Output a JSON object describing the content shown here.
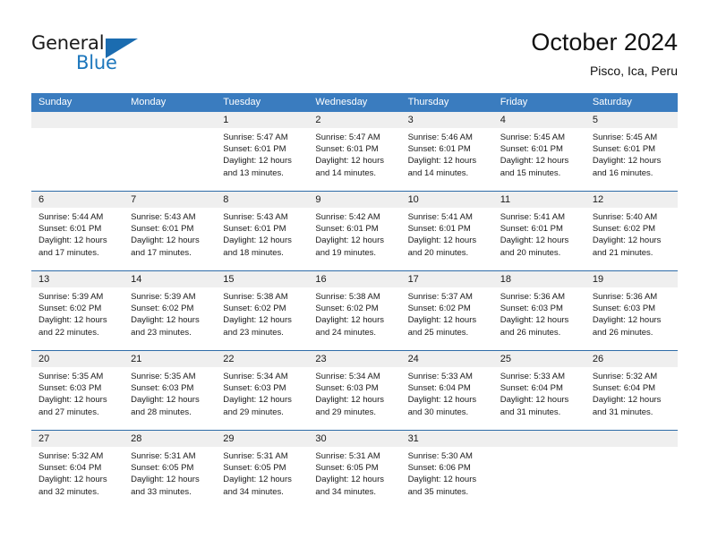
{
  "brand": {
    "name_part1": "General",
    "name_part2": "Blue",
    "logo_icon": "triangle-flag-icon"
  },
  "header": {
    "title": "October 2024",
    "subtitle": "Pisco, Ica, Peru"
  },
  "colors": {
    "header_blue": "#3a7cbf",
    "separator_blue": "#2f6ca8",
    "daynum_band": "#efefef",
    "brand_blue": "#1b76bc"
  },
  "weekdays": [
    "Sunday",
    "Monday",
    "Tuesday",
    "Wednesday",
    "Thursday",
    "Friday",
    "Saturday"
  ],
  "labels": {
    "sunrise_prefix": "Sunrise:",
    "sunset_prefix": "Sunset:",
    "daylight_prefix": "Daylight:"
  },
  "weeks": [
    {
      "days": [
        {
          "num": "",
          "empty": true
        },
        {
          "num": "",
          "empty": true
        },
        {
          "num": "1",
          "sunrise": "Sunrise: 5:47 AM",
          "sunset": "Sunset: 6:01 PM",
          "daylight1": "Daylight: 12 hours",
          "daylight2": "and 13 minutes."
        },
        {
          "num": "2",
          "sunrise": "Sunrise: 5:47 AM",
          "sunset": "Sunset: 6:01 PM",
          "daylight1": "Daylight: 12 hours",
          "daylight2": "and 14 minutes."
        },
        {
          "num": "3",
          "sunrise": "Sunrise: 5:46 AM",
          "sunset": "Sunset: 6:01 PM",
          "daylight1": "Daylight: 12 hours",
          "daylight2": "and 14 minutes."
        },
        {
          "num": "4",
          "sunrise": "Sunrise: 5:45 AM",
          "sunset": "Sunset: 6:01 PM",
          "daylight1": "Daylight: 12 hours",
          "daylight2": "and 15 minutes."
        },
        {
          "num": "5",
          "sunrise": "Sunrise: 5:45 AM",
          "sunset": "Sunset: 6:01 PM",
          "daylight1": "Daylight: 12 hours",
          "daylight2": "and 16 minutes."
        }
      ]
    },
    {
      "days": [
        {
          "num": "6",
          "sunrise": "Sunrise: 5:44 AM",
          "sunset": "Sunset: 6:01 PM",
          "daylight1": "Daylight: 12 hours",
          "daylight2": "and 17 minutes."
        },
        {
          "num": "7",
          "sunrise": "Sunrise: 5:43 AM",
          "sunset": "Sunset: 6:01 PM",
          "daylight1": "Daylight: 12 hours",
          "daylight2": "and 17 minutes."
        },
        {
          "num": "8",
          "sunrise": "Sunrise: 5:43 AM",
          "sunset": "Sunset: 6:01 PM",
          "daylight1": "Daylight: 12 hours",
          "daylight2": "and 18 minutes."
        },
        {
          "num": "9",
          "sunrise": "Sunrise: 5:42 AM",
          "sunset": "Sunset: 6:01 PM",
          "daylight1": "Daylight: 12 hours",
          "daylight2": "and 19 minutes."
        },
        {
          "num": "10",
          "sunrise": "Sunrise: 5:41 AM",
          "sunset": "Sunset: 6:01 PM",
          "daylight1": "Daylight: 12 hours",
          "daylight2": "and 20 minutes."
        },
        {
          "num": "11",
          "sunrise": "Sunrise: 5:41 AM",
          "sunset": "Sunset: 6:01 PM",
          "daylight1": "Daylight: 12 hours",
          "daylight2": "and 20 minutes."
        },
        {
          "num": "12",
          "sunrise": "Sunrise: 5:40 AM",
          "sunset": "Sunset: 6:02 PM",
          "daylight1": "Daylight: 12 hours",
          "daylight2": "and 21 minutes."
        }
      ]
    },
    {
      "days": [
        {
          "num": "13",
          "sunrise": "Sunrise: 5:39 AM",
          "sunset": "Sunset: 6:02 PM",
          "daylight1": "Daylight: 12 hours",
          "daylight2": "and 22 minutes."
        },
        {
          "num": "14",
          "sunrise": "Sunrise: 5:39 AM",
          "sunset": "Sunset: 6:02 PM",
          "daylight1": "Daylight: 12 hours",
          "daylight2": "and 23 minutes."
        },
        {
          "num": "15",
          "sunrise": "Sunrise: 5:38 AM",
          "sunset": "Sunset: 6:02 PM",
          "daylight1": "Daylight: 12 hours",
          "daylight2": "and 23 minutes."
        },
        {
          "num": "16",
          "sunrise": "Sunrise: 5:38 AM",
          "sunset": "Sunset: 6:02 PM",
          "daylight1": "Daylight: 12 hours",
          "daylight2": "and 24 minutes."
        },
        {
          "num": "17",
          "sunrise": "Sunrise: 5:37 AM",
          "sunset": "Sunset: 6:02 PM",
          "daylight1": "Daylight: 12 hours",
          "daylight2": "and 25 minutes."
        },
        {
          "num": "18",
          "sunrise": "Sunrise: 5:36 AM",
          "sunset": "Sunset: 6:03 PM",
          "daylight1": "Daylight: 12 hours",
          "daylight2": "and 26 minutes."
        },
        {
          "num": "19",
          "sunrise": "Sunrise: 5:36 AM",
          "sunset": "Sunset: 6:03 PM",
          "daylight1": "Daylight: 12 hours",
          "daylight2": "and 26 minutes."
        }
      ]
    },
    {
      "days": [
        {
          "num": "20",
          "sunrise": "Sunrise: 5:35 AM",
          "sunset": "Sunset: 6:03 PM",
          "daylight1": "Daylight: 12 hours",
          "daylight2": "and 27 minutes."
        },
        {
          "num": "21",
          "sunrise": "Sunrise: 5:35 AM",
          "sunset": "Sunset: 6:03 PM",
          "daylight1": "Daylight: 12 hours",
          "daylight2": "and 28 minutes."
        },
        {
          "num": "22",
          "sunrise": "Sunrise: 5:34 AM",
          "sunset": "Sunset: 6:03 PM",
          "daylight1": "Daylight: 12 hours",
          "daylight2": "and 29 minutes."
        },
        {
          "num": "23",
          "sunrise": "Sunrise: 5:34 AM",
          "sunset": "Sunset: 6:03 PM",
          "daylight1": "Daylight: 12 hours",
          "daylight2": "and 29 minutes."
        },
        {
          "num": "24",
          "sunrise": "Sunrise: 5:33 AM",
          "sunset": "Sunset: 6:04 PM",
          "daylight1": "Daylight: 12 hours",
          "daylight2": "and 30 minutes."
        },
        {
          "num": "25",
          "sunrise": "Sunrise: 5:33 AM",
          "sunset": "Sunset: 6:04 PM",
          "daylight1": "Daylight: 12 hours",
          "daylight2": "and 31 minutes."
        },
        {
          "num": "26",
          "sunrise": "Sunrise: 5:32 AM",
          "sunset": "Sunset: 6:04 PM",
          "daylight1": "Daylight: 12 hours",
          "daylight2": "and 31 minutes."
        }
      ]
    },
    {
      "days": [
        {
          "num": "27",
          "sunrise": "Sunrise: 5:32 AM",
          "sunset": "Sunset: 6:04 PM",
          "daylight1": "Daylight: 12 hours",
          "daylight2": "and 32 minutes."
        },
        {
          "num": "28",
          "sunrise": "Sunrise: 5:31 AM",
          "sunset": "Sunset: 6:05 PM",
          "daylight1": "Daylight: 12 hours",
          "daylight2": "and 33 minutes."
        },
        {
          "num": "29",
          "sunrise": "Sunrise: 5:31 AM",
          "sunset": "Sunset: 6:05 PM",
          "daylight1": "Daylight: 12 hours",
          "daylight2": "and 34 minutes."
        },
        {
          "num": "30",
          "sunrise": "Sunrise: 5:31 AM",
          "sunset": "Sunset: 6:05 PM",
          "daylight1": "Daylight: 12 hours",
          "daylight2": "and 34 minutes."
        },
        {
          "num": "31",
          "sunrise": "Sunrise: 5:30 AM",
          "sunset": "Sunset: 6:06 PM",
          "daylight1": "Daylight: 12 hours",
          "daylight2": "and 35 minutes."
        },
        {
          "num": "",
          "empty": true
        },
        {
          "num": "",
          "empty": true
        }
      ]
    }
  ]
}
